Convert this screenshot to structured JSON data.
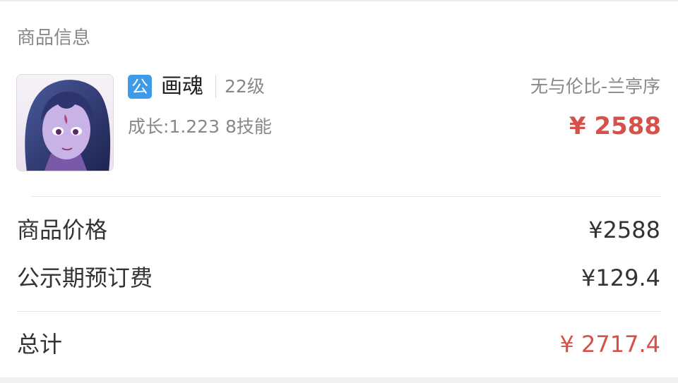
{
  "section": {
    "title": "商品信息"
  },
  "product": {
    "image_icon": "pet-portrait",
    "badge": "公",
    "name": "画魂",
    "level": "22级",
    "attributes": "成长:1.223 8技能",
    "server": "无与伦比-兰亭序",
    "price": "¥ 2588"
  },
  "fees": [
    {
      "label": "商品价格",
      "value": "¥2588"
    },
    {
      "label": "公示期预订费",
      "value": "¥129.4"
    }
  ],
  "total": {
    "label": "总计",
    "value": "¥ 2717.4"
  },
  "colors": {
    "accent_price": "#d5514a",
    "badge_blue": "#3d9be9",
    "muted_text": "#888888"
  }
}
